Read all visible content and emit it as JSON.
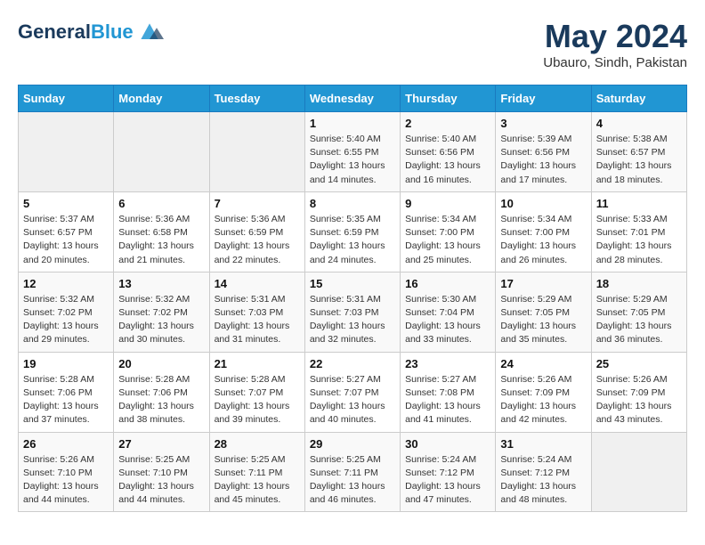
{
  "header": {
    "logo_line1": "General",
    "logo_line2": "Blue",
    "month": "May 2024",
    "location": "Ubauro, Sindh, Pakistan"
  },
  "days_of_week": [
    "Sunday",
    "Monday",
    "Tuesday",
    "Wednesday",
    "Thursday",
    "Friday",
    "Saturday"
  ],
  "weeks": [
    [
      {
        "day": "",
        "sunrise": "",
        "sunset": "",
        "daylight": ""
      },
      {
        "day": "",
        "sunrise": "",
        "sunset": "",
        "daylight": ""
      },
      {
        "day": "",
        "sunrise": "",
        "sunset": "",
        "daylight": ""
      },
      {
        "day": "1",
        "sunrise": "Sunrise: 5:40 AM",
        "sunset": "Sunset: 6:55 PM",
        "daylight": "Daylight: 13 hours and 14 minutes."
      },
      {
        "day": "2",
        "sunrise": "Sunrise: 5:40 AM",
        "sunset": "Sunset: 6:56 PM",
        "daylight": "Daylight: 13 hours and 16 minutes."
      },
      {
        "day": "3",
        "sunrise": "Sunrise: 5:39 AM",
        "sunset": "Sunset: 6:56 PM",
        "daylight": "Daylight: 13 hours and 17 minutes."
      },
      {
        "day": "4",
        "sunrise": "Sunrise: 5:38 AM",
        "sunset": "Sunset: 6:57 PM",
        "daylight": "Daylight: 13 hours and 18 minutes."
      }
    ],
    [
      {
        "day": "5",
        "sunrise": "Sunrise: 5:37 AM",
        "sunset": "Sunset: 6:57 PM",
        "daylight": "Daylight: 13 hours and 20 minutes."
      },
      {
        "day": "6",
        "sunrise": "Sunrise: 5:36 AM",
        "sunset": "Sunset: 6:58 PM",
        "daylight": "Daylight: 13 hours and 21 minutes."
      },
      {
        "day": "7",
        "sunrise": "Sunrise: 5:36 AM",
        "sunset": "Sunset: 6:59 PM",
        "daylight": "Daylight: 13 hours and 22 minutes."
      },
      {
        "day": "8",
        "sunrise": "Sunrise: 5:35 AM",
        "sunset": "Sunset: 6:59 PM",
        "daylight": "Daylight: 13 hours and 24 minutes."
      },
      {
        "day": "9",
        "sunrise": "Sunrise: 5:34 AM",
        "sunset": "Sunset: 7:00 PM",
        "daylight": "Daylight: 13 hours and 25 minutes."
      },
      {
        "day": "10",
        "sunrise": "Sunrise: 5:34 AM",
        "sunset": "Sunset: 7:00 PM",
        "daylight": "Daylight: 13 hours and 26 minutes."
      },
      {
        "day": "11",
        "sunrise": "Sunrise: 5:33 AM",
        "sunset": "Sunset: 7:01 PM",
        "daylight": "Daylight: 13 hours and 28 minutes."
      }
    ],
    [
      {
        "day": "12",
        "sunrise": "Sunrise: 5:32 AM",
        "sunset": "Sunset: 7:02 PM",
        "daylight": "Daylight: 13 hours and 29 minutes."
      },
      {
        "day": "13",
        "sunrise": "Sunrise: 5:32 AM",
        "sunset": "Sunset: 7:02 PM",
        "daylight": "Daylight: 13 hours and 30 minutes."
      },
      {
        "day": "14",
        "sunrise": "Sunrise: 5:31 AM",
        "sunset": "Sunset: 7:03 PM",
        "daylight": "Daylight: 13 hours and 31 minutes."
      },
      {
        "day": "15",
        "sunrise": "Sunrise: 5:31 AM",
        "sunset": "Sunset: 7:03 PM",
        "daylight": "Daylight: 13 hours and 32 minutes."
      },
      {
        "day": "16",
        "sunrise": "Sunrise: 5:30 AM",
        "sunset": "Sunset: 7:04 PM",
        "daylight": "Daylight: 13 hours and 33 minutes."
      },
      {
        "day": "17",
        "sunrise": "Sunrise: 5:29 AM",
        "sunset": "Sunset: 7:05 PM",
        "daylight": "Daylight: 13 hours and 35 minutes."
      },
      {
        "day": "18",
        "sunrise": "Sunrise: 5:29 AM",
        "sunset": "Sunset: 7:05 PM",
        "daylight": "Daylight: 13 hours and 36 minutes."
      }
    ],
    [
      {
        "day": "19",
        "sunrise": "Sunrise: 5:28 AM",
        "sunset": "Sunset: 7:06 PM",
        "daylight": "Daylight: 13 hours and 37 minutes."
      },
      {
        "day": "20",
        "sunrise": "Sunrise: 5:28 AM",
        "sunset": "Sunset: 7:06 PM",
        "daylight": "Daylight: 13 hours and 38 minutes."
      },
      {
        "day": "21",
        "sunrise": "Sunrise: 5:28 AM",
        "sunset": "Sunset: 7:07 PM",
        "daylight": "Daylight: 13 hours and 39 minutes."
      },
      {
        "day": "22",
        "sunrise": "Sunrise: 5:27 AM",
        "sunset": "Sunset: 7:07 PM",
        "daylight": "Daylight: 13 hours and 40 minutes."
      },
      {
        "day": "23",
        "sunrise": "Sunrise: 5:27 AM",
        "sunset": "Sunset: 7:08 PM",
        "daylight": "Daylight: 13 hours and 41 minutes."
      },
      {
        "day": "24",
        "sunrise": "Sunrise: 5:26 AM",
        "sunset": "Sunset: 7:09 PM",
        "daylight": "Daylight: 13 hours and 42 minutes."
      },
      {
        "day": "25",
        "sunrise": "Sunrise: 5:26 AM",
        "sunset": "Sunset: 7:09 PM",
        "daylight": "Daylight: 13 hours and 43 minutes."
      }
    ],
    [
      {
        "day": "26",
        "sunrise": "Sunrise: 5:26 AM",
        "sunset": "Sunset: 7:10 PM",
        "daylight": "Daylight: 13 hours and 44 minutes."
      },
      {
        "day": "27",
        "sunrise": "Sunrise: 5:25 AM",
        "sunset": "Sunset: 7:10 PM",
        "daylight": "Daylight: 13 hours and 44 minutes."
      },
      {
        "day": "28",
        "sunrise": "Sunrise: 5:25 AM",
        "sunset": "Sunset: 7:11 PM",
        "daylight": "Daylight: 13 hours and 45 minutes."
      },
      {
        "day": "29",
        "sunrise": "Sunrise: 5:25 AM",
        "sunset": "Sunset: 7:11 PM",
        "daylight": "Daylight: 13 hours and 46 minutes."
      },
      {
        "day": "30",
        "sunrise": "Sunrise: 5:24 AM",
        "sunset": "Sunset: 7:12 PM",
        "daylight": "Daylight: 13 hours and 47 minutes."
      },
      {
        "day": "31",
        "sunrise": "Sunrise: 5:24 AM",
        "sunset": "Sunset: 7:12 PM",
        "daylight": "Daylight: 13 hours and 48 minutes."
      },
      {
        "day": "",
        "sunrise": "",
        "sunset": "",
        "daylight": ""
      }
    ]
  ]
}
